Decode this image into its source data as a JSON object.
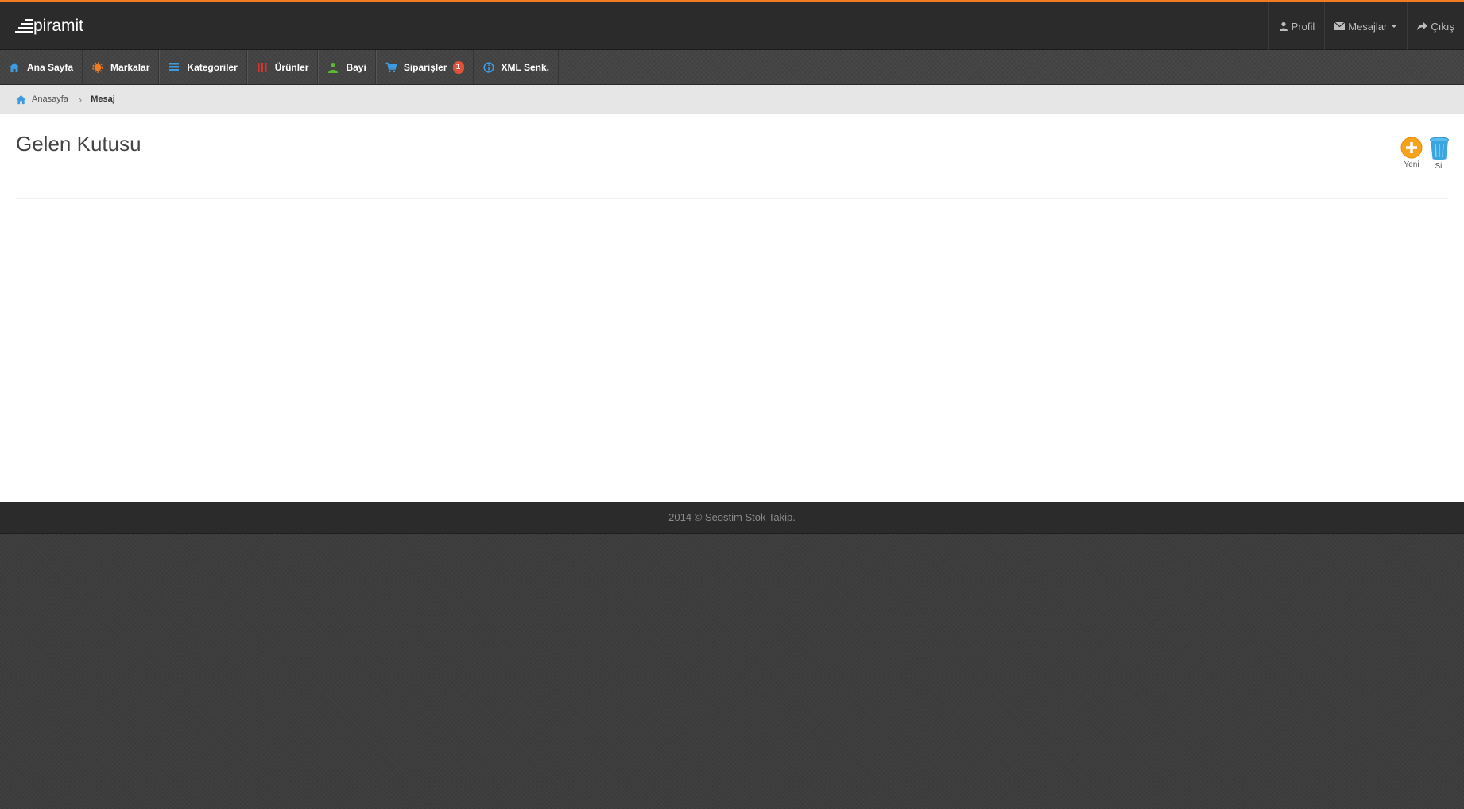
{
  "header": {
    "logo_text": "piramit",
    "links": {
      "profile": "Profil",
      "messages": "Mesajlar",
      "logout": "Çıkış"
    }
  },
  "nav": {
    "items": [
      {
        "label": "Ana Sayfa",
        "icon": "home-icon"
      },
      {
        "label": "Markalar",
        "icon": "brand-icon"
      },
      {
        "label": "Kategoriler",
        "icon": "list-icon"
      },
      {
        "label": "Ürünler",
        "icon": "products-icon"
      },
      {
        "label": "Bayi",
        "icon": "user-icon"
      },
      {
        "label": "Siparişler",
        "icon": "cart-icon",
        "badge": "1"
      },
      {
        "label": "XML Senk.",
        "icon": "info-icon"
      }
    ]
  },
  "breadcrumb": {
    "home": "Anasayfa",
    "current": "Mesaj"
  },
  "main": {
    "title": "Gelen Kutusu",
    "actions": {
      "new_label": "Yeni",
      "delete_label": "Sil"
    }
  },
  "footer": {
    "text": "2014 © Seostim Stok Takip."
  },
  "colors": {
    "accent": "#f07b22",
    "topbar": "#2b2b2b",
    "badge": "#e0533a",
    "new_button": "#f7a21b",
    "delete_button": "#3aa6e0"
  }
}
